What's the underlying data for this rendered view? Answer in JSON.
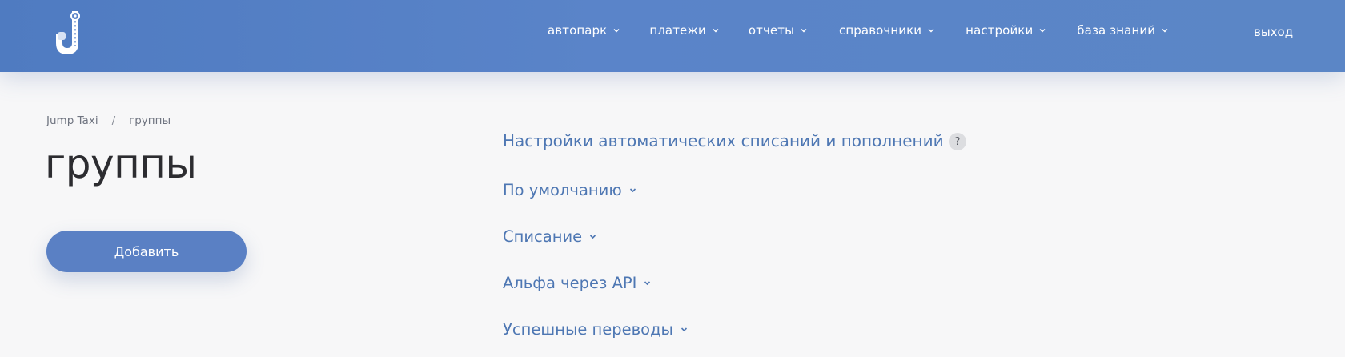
{
  "header": {
    "logo_icon": "jump-taxi-logo",
    "nav": [
      {
        "label": "автопарк"
      },
      {
        "label": "платежи"
      },
      {
        "label": "отчеты"
      },
      {
        "label": "справочники"
      },
      {
        "label": "настройки"
      },
      {
        "label": "база знаний"
      }
    ],
    "logout_label": "выход"
  },
  "breadcrumb": {
    "root": "Jump Taxi",
    "separator": "/",
    "current": "группы"
  },
  "page": {
    "title": "группы",
    "add_button_label": "Добавить"
  },
  "settings": {
    "title": "Настройки автоматических списаний и пополнений",
    "help_label": "?"
  },
  "groups": [
    {
      "label": "По умолчанию"
    },
    {
      "label": "Списание"
    },
    {
      "label": "Альфа через API"
    },
    {
      "label": "Успешные переводы"
    }
  ],
  "colors": {
    "header_bg": "#5a84c9",
    "accent": "#4e77b3",
    "button_bg": "#5a80c4",
    "page_bg": "#f7f7f8"
  }
}
